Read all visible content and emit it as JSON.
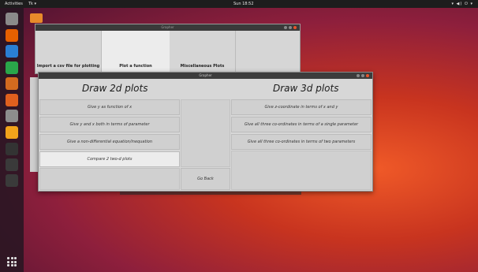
{
  "topbar": {
    "activities": "Activities",
    "app_menu": "Tk ▾",
    "clock": "Sun 18:52",
    "tray": "▾ ◀) ⏻ ▾"
  },
  "dock": {
    "items": [
      {
        "name": "folder-icon",
        "color": "#8a8a8a"
      },
      {
        "name": "firefox-icon",
        "color": "#e66000"
      },
      {
        "name": "writer-icon",
        "color": "#2a7fd4"
      },
      {
        "name": "calc-icon",
        "color": "#2aa64a"
      },
      {
        "name": "impress-icon",
        "color": "#d46a1f"
      },
      {
        "name": "software-icon",
        "color": "#e0601e"
      },
      {
        "name": "settings-icon",
        "color": "#8d8d8d"
      },
      {
        "name": "sublime-icon",
        "color": "#f2a31b"
      },
      {
        "name": "terminal-icon",
        "color": "#333333"
      },
      {
        "name": "app-icon-1",
        "color": "#3a3a3a"
      },
      {
        "name": "app-icon-2",
        "color": "#3a3a3a"
      }
    ]
  },
  "back_window": {
    "title": "Grapher",
    "tiles": [
      "Import a csv file for plotting",
      "Plot a function",
      "Miscellaneous Plots",
      ""
    ]
  },
  "front_window": {
    "title": "Grapher",
    "heading_2d": "Draw 2d plots",
    "heading_3d": "Draw 3d plots",
    "buttons_2d": [
      "Give y as function of x",
      "Give y and x both in terms of parameter",
      "Give a non-differential equation/inequation",
      "Compare 2 two-d plots"
    ],
    "buttons_3d": [
      "Give z-coordinate in terms of x and y",
      "Give all three co-ordinates in terms of a single parameter",
      "Give all three co-ordinates in terms of two parameters"
    ],
    "go_back": "Go Back"
  }
}
